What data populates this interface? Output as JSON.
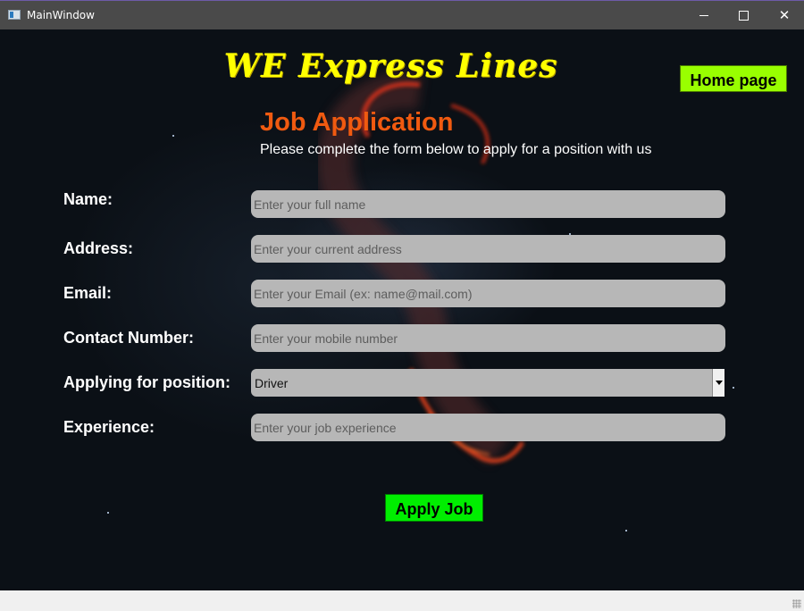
{
  "window": {
    "title": "MainWindow",
    "minimize_glyph": "",
    "close_glyph": "✕"
  },
  "header": {
    "brand": "WE Express Lines",
    "home_button": "Home page"
  },
  "form": {
    "title": "Job Application",
    "subtitle": "Please complete the form below to apply for a position with us",
    "fields": [
      {
        "label": "Name:",
        "placeholder": "Enter your full name",
        "value": ""
      },
      {
        "label": "Address:",
        "placeholder": "Enter your current address",
        "value": ""
      },
      {
        "label": "Email:",
        "placeholder": "Enter your Email (ex: name@mail.com)",
        "value": ""
      },
      {
        "label": "Contact Number:",
        "placeholder": "Enter your mobile number",
        "value": ""
      },
      {
        "label": "Applying for position:",
        "selected": "Driver"
      },
      {
        "label": "Experience:",
        "placeholder": "Enter your job experience",
        "value": ""
      }
    ],
    "submit": "Apply Job"
  },
  "colors": {
    "brand": "#ffff00",
    "heading": "#f05a10",
    "home_button_bg": "#99ff00",
    "apply_button_bg": "#00ee00",
    "field_bg": "#b7b7b7"
  },
  "icons": {
    "app": "app-window-icon",
    "minimize": "minimize-icon",
    "maximize": "maximize-icon",
    "close": "close-icon",
    "dropdown": "chevron-down-icon",
    "resize": "resize-grip-icon"
  }
}
